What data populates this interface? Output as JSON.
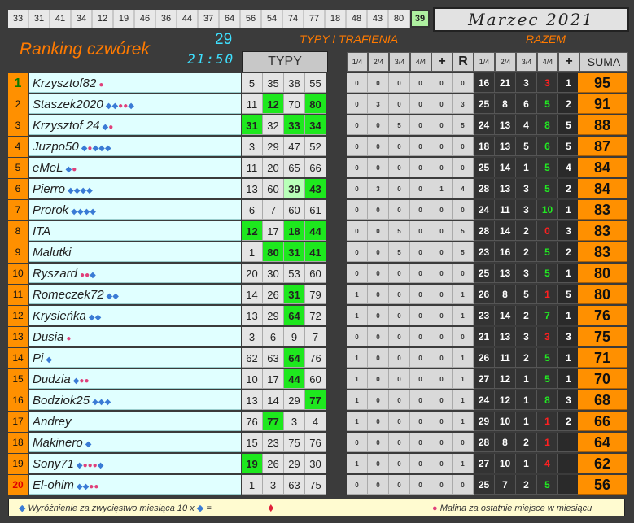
{
  "top_numbers": [
    "33",
    "31",
    "41",
    "34",
    "12",
    "19",
    "46",
    "36",
    "44",
    "37",
    "64",
    "56",
    "54",
    "74",
    "77",
    "18",
    "48",
    "43",
    "80",
    "39"
  ],
  "highlight_number": "39",
  "month": "Marzec 2021",
  "title": "Ranking czwórek",
  "count": "29",
  "time": "21:50",
  "header_typy_trafienia": "TYPY I TRAFIENIA",
  "header_razem": "RAZEM",
  "typy_label": "TYPY",
  "tr_headers": [
    "1/4",
    "2/4",
    "3/4",
    "4/4",
    "+",
    "R"
  ],
  "rz_headers": [
    "1/4",
    "2/4",
    "3/4",
    "4/4",
    "+"
  ],
  "suma_label": "SUMA",
  "colors": {
    "orange": "#ff9000",
    "green": "#1ee81e",
    "cyan": "#3ee0ff"
  },
  "rows": [
    {
      "rank": "1",
      "name": "Krzysztof82",
      "icons": "R",
      "typy": [
        "5",
        "35",
        "38",
        "55"
      ],
      "hits": [],
      "tr": [
        "0",
        "0",
        "0",
        "0",
        "0",
        "0"
      ],
      "rz": [
        "16",
        "21",
        "3",
        "3",
        "1"
      ],
      "sum": "95"
    },
    {
      "rank": "2",
      "name": "Staszek2020",
      "icons": "DDRRD",
      "typy": [
        "11",
        "12",
        "70",
        "80"
      ],
      "hits": [
        1,
        3
      ],
      "tr": [
        "0",
        "3",
        "0",
        "0",
        "0",
        "3"
      ],
      "rz": [
        "25",
        "8",
        "6",
        "5",
        "2"
      ],
      "sum": "91"
    },
    {
      "rank": "3",
      "name": "Krzysztof 24",
      "icons": "DR",
      "typy": [
        "31",
        "32",
        "33",
        "34"
      ],
      "hits": [
        0,
        2,
        3
      ],
      "tr": [
        "0",
        "0",
        "5",
        "0",
        "0",
        "5"
      ],
      "rz": [
        "24",
        "13",
        "4",
        "8",
        "5"
      ],
      "sum": "88"
    },
    {
      "rank": "4",
      "name": "Juzpo50",
      "icons": "DRDDD",
      "typy": [
        "3",
        "29",
        "47",
        "52"
      ],
      "hits": [],
      "tr": [
        "0",
        "0",
        "0",
        "0",
        "0",
        "0"
      ],
      "rz": [
        "18",
        "13",
        "5",
        "6",
        "5"
      ],
      "sum": "87"
    },
    {
      "rank": "5",
      "name": "eMeL",
      "icons": "DR",
      "typy": [
        "11",
        "20",
        "65",
        "66"
      ],
      "hits": [],
      "tr": [
        "0",
        "0",
        "0",
        "0",
        "0",
        "0"
      ],
      "rz": [
        "25",
        "14",
        "1",
        "5",
        "4"
      ],
      "sum": "84"
    },
    {
      "rank": "6",
      "name": "Pierro",
      "icons": "DDDD",
      "typy": [
        "13",
        "60",
        "39",
        "43"
      ],
      "hits": [],
      "light": [
        2
      ],
      "hit": [
        3
      ],
      "tr": [
        "0",
        "3",
        "0",
        "0",
        "1",
        "4"
      ],
      "rz": [
        "28",
        "13",
        "3",
        "5",
        "2"
      ],
      "sum": "84"
    },
    {
      "rank": "7",
      "name": "Prorok",
      "icons": "DDDD",
      "typy": [
        "6",
        "7",
        "60",
        "61"
      ],
      "hits": [],
      "tr": [
        "0",
        "0",
        "0",
        "0",
        "0",
        "0"
      ],
      "rz": [
        "24",
        "11",
        "3",
        "10",
        "1"
      ],
      "sum": "83"
    },
    {
      "rank": "8",
      "name": "ITA",
      "icons": "",
      "typy": [
        "12",
        "17",
        "18",
        "44"
      ],
      "hits": [
        0,
        2,
        3
      ],
      "tr": [
        "0",
        "0",
        "5",
        "0",
        "0",
        "5"
      ],
      "rz": [
        "28",
        "14",
        "2",
        "0",
        "3"
      ],
      "sum": "83"
    },
    {
      "rank": "9",
      "name": "Malutki",
      "icons": "",
      "typy": [
        "1",
        "80",
        "31",
        "41"
      ],
      "hits": [
        1,
        2,
        3
      ],
      "tr": [
        "0",
        "0",
        "5",
        "0",
        "0",
        "5"
      ],
      "rz": [
        "23",
        "16",
        "2",
        "5",
        "2"
      ],
      "sum": "83"
    },
    {
      "rank": "10",
      "name": "Ryszard",
      "icons": "RRD",
      "typy": [
        "20",
        "30",
        "53",
        "60"
      ],
      "hits": [],
      "tr": [
        "0",
        "0",
        "0",
        "0",
        "0",
        "0"
      ],
      "rz": [
        "25",
        "13",
        "3",
        "5",
        "1"
      ],
      "sum": "80"
    },
    {
      "rank": "11",
      "name": "Romeczek72",
      "icons": "DD",
      "typy": [
        "14",
        "26",
        "31",
        "79"
      ],
      "hits": [
        2
      ],
      "tr": [
        "1",
        "0",
        "0",
        "0",
        "0",
        "1"
      ],
      "rz": [
        "26",
        "8",
        "5",
        "1",
        "5"
      ],
      "sum": "80"
    },
    {
      "rank": "12",
      "name": "Krysieńka",
      "icons": "DD",
      "typy": [
        "13",
        "29",
        "64",
        "72"
      ],
      "hits": [
        2
      ],
      "tr": [
        "1",
        "0",
        "0",
        "0",
        "0",
        "1"
      ],
      "rz": [
        "23",
        "14",
        "2",
        "7",
        "1"
      ],
      "sum": "76"
    },
    {
      "rank": "13",
      "name": "Dusia",
      "icons": "R",
      "typy": [
        "3",
        "6",
        "9",
        "7"
      ],
      "hits": [],
      "tr": [
        "0",
        "0",
        "0",
        "0",
        "0",
        "0"
      ],
      "rz": [
        "21",
        "13",
        "3",
        "3",
        "3"
      ],
      "sum": "75"
    },
    {
      "rank": "14",
      "name": "Pi",
      "icons": "D",
      "typy": [
        "62",
        "63",
        "64",
        "76"
      ],
      "hits": [
        2
      ],
      "tr": [
        "1",
        "0",
        "0",
        "0",
        "0",
        "1"
      ],
      "rz": [
        "26",
        "11",
        "2",
        "5",
        "1"
      ],
      "sum": "71"
    },
    {
      "rank": "15",
      "name": "Dudzia",
      "icons": "DRR",
      "typy": [
        "10",
        "17",
        "44",
        "60"
      ],
      "hits": [
        2
      ],
      "tr": [
        "1",
        "0",
        "0",
        "0",
        "0",
        "1"
      ],
      "rz": [
        "27",
        "12",
        "1",
        "5",
        "1"
      ],
      "sum": "70"
    },
    {
      "rank": "16",
      "name": "Bodziok25",
      "icons": "DDD",
      "typy": [
        "13",
        "14",
        "29",
        "77"
      ],
      "hits": [
        3
      ],
      "tr": [
        "1",
        "0",
        "0",
        "0",
        "0",
        "1"
      ],
      "rz": [
        "24",
        "12",
        "1",
        "8",
        "3"
      ],
      "sum": "68"
    },
    {
      "rank": "17",
      "name": "Andrey",
      "icons": "",
      "typy": [
        "76",
        "77",
        "3",
        "4"
      ],
      "hits": [
        1
      ],
      "tr": [
        "1",
        "0",
        "0",
        "0",
        "0",
        "1"
      ],
      "rz": [
        "29",
        "10",
        "1",
        "1",
        "2"
      ],
      "sum": "66"
    },
    {
      "rank": "18",
      "name": "Makinero",
      "icons": "D",
      "typy": [
        "15",
        "23",
        "75",
        "76"
      ],
      "hits": [],
      "tr": [
        "0",
        "0",
        "0",
        "0",
        "0",
        "0"
      ],
      "rz": [
        "28",
        "8",
        "2",
        "1",
        ""
      ],
      "sum": "64"
    },
    {
      "rank": "19",
      "name": "Sony71",
      "icons": "DRRRD",
      "typy": [
        "19",
        "26",
        "29",
        "30"
      ],
      "hits": [
        0
      ],
      "tr": [
        "1",
        "0",
        "0",
        "0",
        "0",
        "1"
      ],
      "rz": [
        "27",
        "10",
        "1",
        "4",
        ""
      ],
      "sum": "62"
    },
    {
      "rank": "20",
      "name": "El-ohim",
      "icons": "DDRR",
      "typy": [
        "1",
        "3",
        "63",
        "75"
      ],
      "hits": [],
      "tr": [
        "0",
        "0",
        "0",
        "0",
        "0",
        "0"
      ],
      "rz": [
        "25",
        "7",
        "2",
        "5",
        ""
      ],
      "sum": "56"
    }
  ],
  "footer_left": "Wyróżnienie za zwycięstwo miesiąca  10 x",
  "footer_eq": "=",
  "footer_right": "Malina za ostatnie miejsce w miesiącu"
}
